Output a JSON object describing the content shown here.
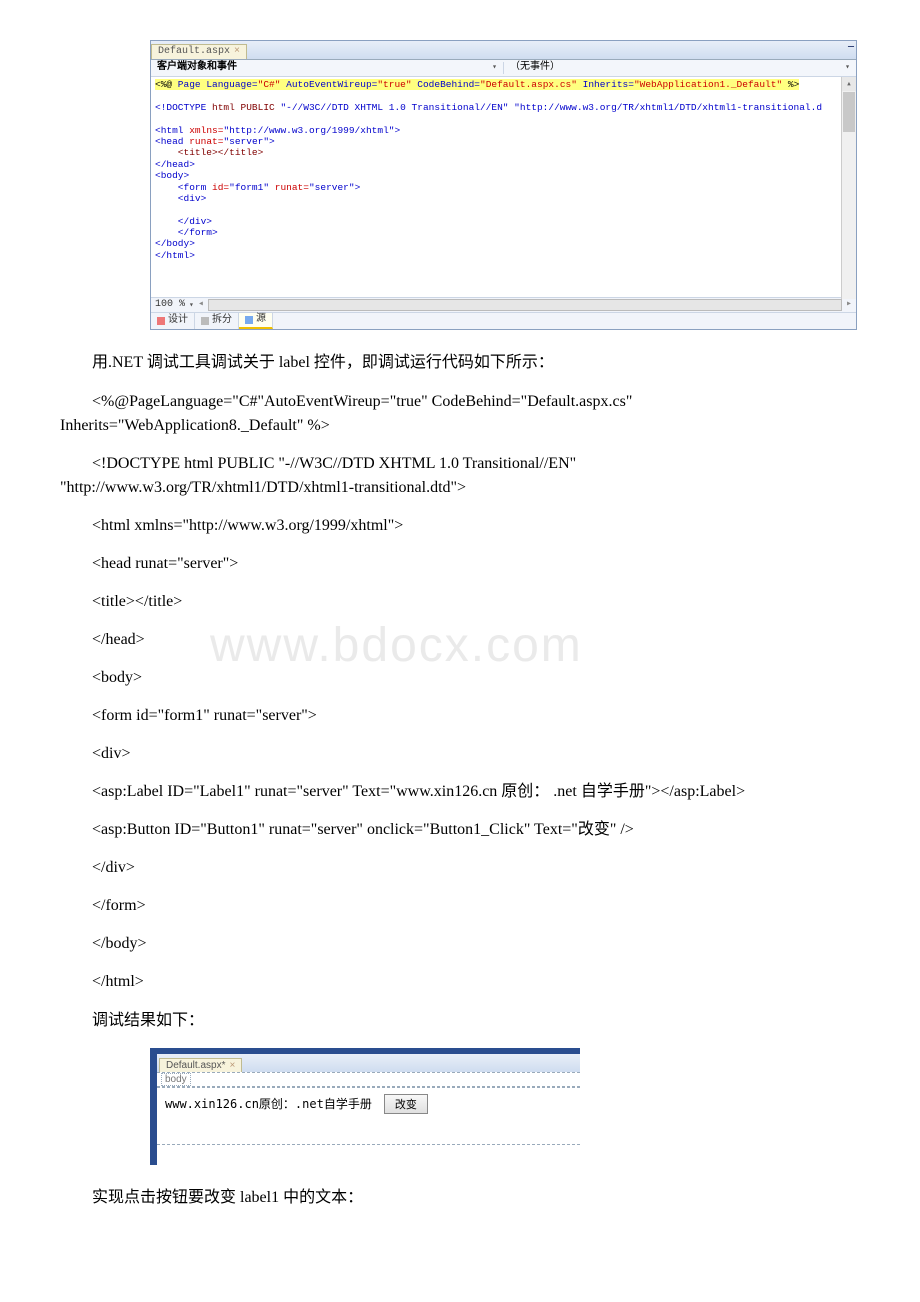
{
  "ide": {
    "tab_name": "Default.aspx",
    "dropdown_left": "客户端对象和事件",
    "dropdown_right": "（无事件）",
    "zoom": "100 %",
    "view_design": "设计",
    "view_split": "拆分",
    "view_source": "源",
    "code_line1_a": "<%@",
    "code_line1_b": " Page Language=",
    "code_line1_c": "\"C#\"",
    "code_line1_d": " AutoEventWireup=",
    "code_line1_e": "\"true\"",
    "code_line1_f": " CodeBehind=",
    "code_line1_g": "\"Default.aspx.cs\"",
    "code_line1_h": " Inherits=",
    "code_line1_i": "\"WebApplication1._Default\"",
    "code_line1_j": " %>",
    "code_line2_a": "<!DOCTYPE",
    "code_line2_b": " html PUBLIC ",
    "code_line2_c": "\"-//W3C//DTD XHTML 1.0 Transitional//EN\" \"http://www.w3.org/TR/xhtml1/DTD/xhtml1-transitional.d",
    "code_line3_a": "<html ",
    "code_line3_b": "xmlns=",
    "code_line3_c": "\"http://www.w3.org/1999/xhtml\"",
    "code_line3_d": ">",
    "code_line4_a": "<head ",
    "code_line4_b": "runat=",
    "code_line4_c": "\"server\"",
    "code_line4_d": ">",
    "code_line5": "    <title></title>",
    "code_line6": "</head>",
    "code_line7": "<body>",
    "code_line8_a": "    <form ",
    "code_line8_b": "id=",
    "code_line8_c": "\"form1\"",
    "code_line8_d": " runat=",
    "code_line8_e": "\"server\"",
    "code_line8_f": ">",
    "code_line9": "    <div>",
    "code_line10": " ",
    "code_line11": "    </div>",
    "code_line12": "    </form>",
    "code_line13": "</body>",
    "code_line14": "</html>"
  },
  "para1": "用.NET 调试工具调试关于 label 控件，即调试运行代码如下所示：",
  "code1a": "<%@PageLanguage=\"C#\"AutoEventWireup=\"true\" CodeBehind=\"Default.aspx.cs\" Inherits=\"WebApplication8._Default\" %>",
  "code2": "<!DOCTYPE html PUBLIC \"-//W3C//DTD XHTML 1.0 Transitional//EN\" \"http://www.w3.org/TR/xhtml1/DTD/xhtml1-transitional.dtd\">",
  "code3": "<html xmlns=\"http://www.w3.org/1999/xhtml\">",
  "code4": "<head runat=\"server\">",
  "code5": " <title></title>",
  "code6": "</head>",
  "code7": "<body>",
  "code8": " <form id=\"form1\" runat=\"server\">",
  "code9": " <div>",
  "code10": " <asp:Label ID=\"Label1\" runat=\"server\" Text=\"www.xin126.cn 原创： .net 自学手册\"></asp:Label>",
  "code11": " <asp:Button ID=\"Button1\" runat=\"server\" onclick=\"Button1_Click\" Text=\"改变\" />",
  "code12": " </div>",
  "code13": " </form>",
  "code14": "</body>",
  "code15": "</html>",
  "para2": " 调试结果如下：",
  "watermark": "www.bdocx.com",
  "designer": {
    "tab_name": "Default.aspx*",
    "crumb": "body",
    "label": "www.xin126.cn原创：.net自学手册",
    "button": "改变"
  },
  "para3": "实现点击按钮要改变 label1 中的文本："
}
